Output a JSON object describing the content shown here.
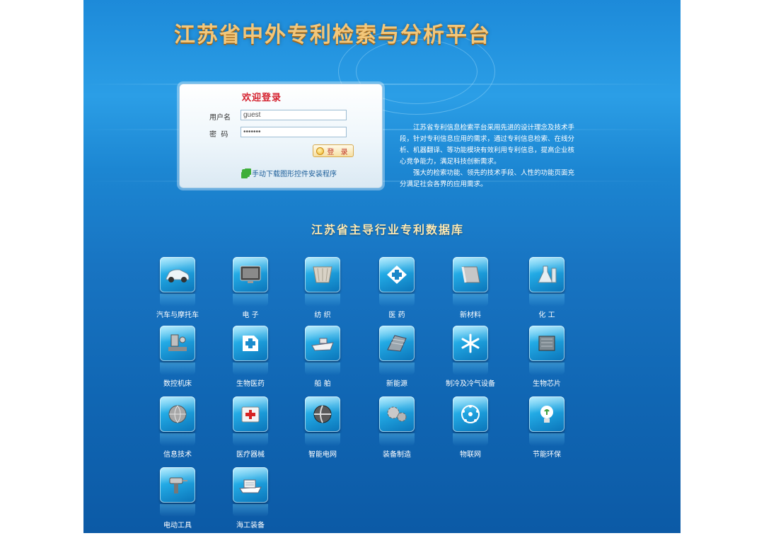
{
  "page": {
    "title": "江苏省中外专利检索与分析平台",
    "login": {
      "heading": "欢迎登录",
      "username_label": "用户名",
      "username_value": "guest",
      "password_label": "密  码",
      "password_value": "•••••••",
      "login_button": "登 录",
      "download_link": "手动下载图形控件安装程序"
    },
    "intro": {
      "paragraph1": "江苏省专利信息检索平台采用先进的设计理念及技术手段，针对专利信息应用的需求，通过专利信息检索、在线分析、机器翻译、等功能模块有效利用专利信息，提高企业核心竞争能力，满足科技创新需求。",
      "paragraph2": "强大的检索功能、领先的技术手段、人性的功能页面充分满足社会各界的应用需求。"
    },
    "section_title": "江苏省主导行业专利数据库",
    "categories": [
      {
        "label": "汽车与摩托车",
        "icon": "car-icon"
      },
      {
        "label": "电 子",
        "icon": "monitor-icon"
      },
      {
        "label": "纺 织",
        "icon": "fabric-icon"
      },
      {
        "label": "医 药",
        "icon": "medicine-icon"
      },
      {
        "label": "新材料",
        "icon": "material-icon"
      },
      {
        "label": "化 工",
        "icon": "flask-icon"
      },
      {
        "label": "数控机床",
        "icon": "machine-tool-icon"
      },
      {
        "label": "生物医药",
        "icon": "bio-medicine-icon"
      },
      {
        "label": "船 舶",
        "icon": "ship-icon"
      },
      {
        "label": "新能源",
        "icon": "solar-icon"
      },
      {
        "label": "制冷及冷气设备",
        "icon": "snowflake-icon"
      },
      {
        "label": "生物芯片",
        "icon": "chip-icon"
      },
      {
        "label": "信息技术",
        "icon": "globe-icon"
      },
      {
        "label": "医疗器械",
        "icon": "medical-kit-icon"
      },
      {
        "label": "智能电网",
        "icon": "grid-sphere-icon"
      },
      {
        "label": "装备制造",
        "icon": "gears-icon"
      },
      {
        "label": "物联网",
        "icon": "network-icon"
      },
      {
        "label": "节能环保",
        "icon": "bulb-icon"
      },
      {
        "label": "电动工具",
        "icon": "drill-icon"
      },
      {
        "label": "海工装备",
        "icon": "offshore-ship-icon"
      }
    ]
  }
}
